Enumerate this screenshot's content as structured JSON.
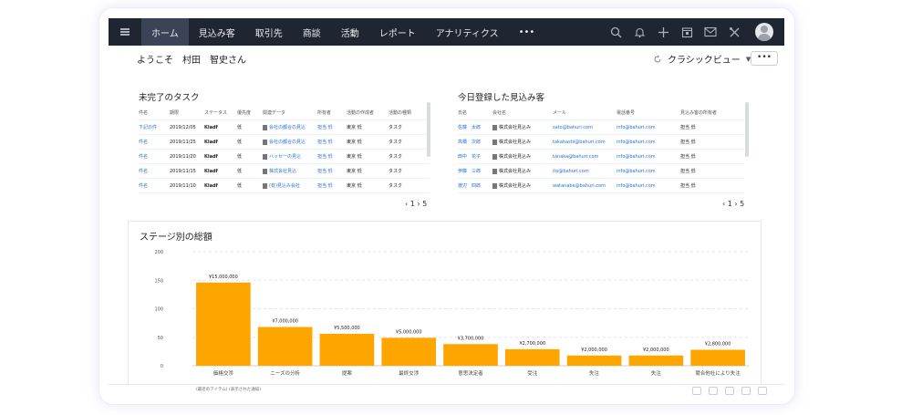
{
  "nav": {
    "tabs": [
      "ホーム",
      "見込み客",
      "取引先",
      "商談",
      "活動",
      "レポート",
      "アナリティクス",
      "•••"
    ],
    "active": 0
  },
  "welcome": "ようこそ　村田　智史さん",
  "view_selector": "クラシックビュー",
  "more_label": "•••",
  "tasks": {
    "title": "未完了のタスク",
    "columns": [
      "件名",
      "期限",
      "ステータス",
      "優先度",
      "関連データ",
      "所有者",
      "活動の作成者",
      "活動の種類"
    ],
    "rows": [
      [
        "下記の件",
        "2019/12/05",
        "Kladf",
        "低",
        "会社の都合の見込",
        "担当 低",
        "東京 低",
        "タスク"
      ],
      [
        "件名",
        "2019/11/25",
        "Kladf",
        "低",
        "会社の都合の見込",
        "担当 低",
        "東京 低",
        "タスク"
      ],
      [
        "件名",
        "2019/11/20",
        "Kladf",
        "低",
        "ハッセーの見込",
        "担当 低",
        "東京 低",
        "タスク"
      ],
      [
        "件名",
        "2019/11/15",
        "Kladf",
        "低",
        "株式会社見込",
        "担当 低",
        "東京 低",
        "タスク"
      ],
      [
        "件名",
        "2019/11/10",
        "Kladf",
        "低",
        "(有)見込み会社",
        "担当 低",
        "東京 低",
        "タスク"
      ]
    ],
    "pager": [
      "1",
      "5"
    ]
  },
  "leads": {
    "title": "今日登録した見込み客",
    "columns": [
      "氏名",
      "会社名",
      "メール",
      "電話番号",
      "見込み客の所有者"
    ],
    "rows": [
      [
        "佐藤　太郎",
        "株式会社見込み",
        "sato@bahuri.com",
        "info@bahuri.com",
        "担当 低"
      ],
      [
        "高橋　次郎",
        "株式会社見込み",
        "takahashi@bahuri.com",
        "info@bahuri.com",
        "担当 低"
      ],
      [
        "田中　花子",
        "株式会社見込み",
        "tanaka@bahuri.com",
        "info@bahuri.com",
        "担当 低"
      ],
      [
        "伊藤　三郎",
        "株式会社見込み",
        "ito@bahuri.com",
        "info@bahuri.com",
        "担当 低"
      ],
      [
        "渡辺　四郎",
        "株式会社見込み",
        "watanabe@bahuri.com",
        "info@bahuri.com",
        "担当 低"
      ]
    ],
    "pager": [
      "1",
      "5"
    ]
  },
  "chart_data": {
    "type": "bar",
    "title": "ステージ別の総額",
    "categories": [
      "価格交渉",
      "ニーズの分析",
      "提案",
      "最終交渉",
      "意思決定者",
      "受注",
      "失注",
      "失注",
      "競合他社により失注"
    ],
    "values": [
      146,
      68,
      56,
      49,
      38,
      29,
      18,
      18,
      28
    ],
    "data_labels": [
      "¥15,000,000",
      "¥7,000,000",
      "¥5,500,000",
      "¥5,000,000",
      "¥3,700,000",
      "¥2,700,000",
      "¥2,000,000",
      "¥2,000,000",
      "¥2,800,000"
    ],
    "yticks": [
      "0",
      "50",
      "100",
      "150",
      "200"
    ],
    "ylim": [
      0,
      200
    ],
    "grid": true,
    "color": "#ffa500"
  },
  "footer": {
    "text": "(最近のアイテム) (表示された通知)"
  }
}
